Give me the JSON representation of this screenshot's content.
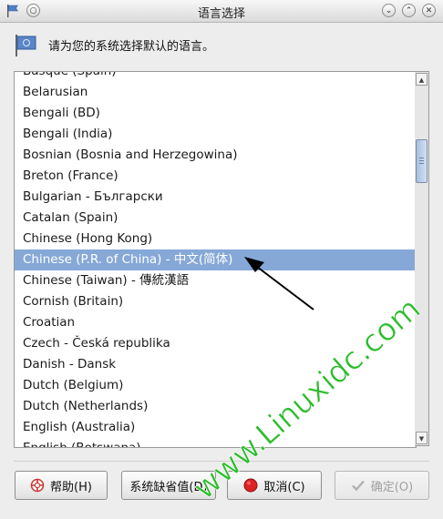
{
  "window": {
    "title": "语言选择"
  },
  "header": {
    "message": "请为您的系统选择默认的语言。"
  },
  "languages": [
    "Basque (Spain)",
    "Belarusian",
    "Bengali (BD)",
    "Bengali (India)",
    "Bosnian (Bosnia and Herzegowina)",
    "Breton (France)",
    "Bulgarian - Български",
    "Catalan (Spain)",
    "Chinese (Hong Kong)",
    "Chinese (P.R. of China) - 中文(简体)",
    "Chinese (Taiwan) - 傳統漢語",
    "Cornish (Britain)",
    "Croatian",
    "Czech - Česká republika",
    "Danish - Dansk",
    "Dutch (Belgium)",
    "Dutch (Netherlands)",
    "English (Australia)",
    "English (Botswana)"
  ],
  "selected_index": 9,
  "buttons": {
    "help": "帮助(H)",
    "defaults": "系统缺省值(D)",
    "cancel": "取消(C)",
    "ok": "确定(O)"
  },
  "watermark": "www.Linuxidc.com",
  "colors": {
    "selection": "#86a8d6",
    "watermark": "#2bbd2b"
  }
}
